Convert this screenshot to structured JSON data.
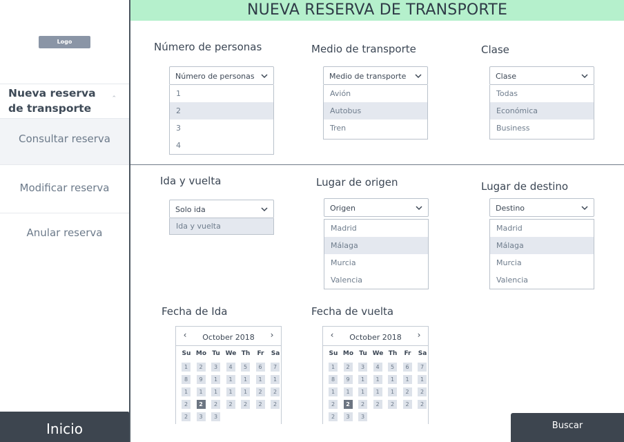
{
  "sidebar": {
    "logo": "Logo",
    "active_item": "Nueva reserva de transporte",
    "items": [
      {
        "label": "Consultar reserva"
      },
      {
        "label": "Modificar reserva"
      },
      {
        "label": "Anular reserva"
      }
    ],
    "home_button": "Inicio"
  },
  "header": {
    "title": "NUEVA RESERVA DE TRANSPORTE",
    "color": "#b5f0cc"
  },
  "form": {
    "personas": {
      "label": "Número de personas",
      "value": "Número de personas",
      "options": [
        "1",
        "2",
        "3",
        "4"
      ],
      "selected": "2"
    },
    "medio": {
      "label": "Medio de transporte",
      "value": "Medio de transporte",
      "options": [
        "Avión",
        "Autobus",
        "Tren"
      ],
      "selected": "Autobus"
    },
    "clase": {
      "label": "Clase",
      "value": "Clase",
      "options": [
        "Todas",
        "Económica",
        "Business"
      ],
      "selected": "Económica"
    },
    "ida_vuelta": {
      "label": "Ida y vuelta",
      "value": "Solo ida",
      "options": [
        "Ida y vuelta"
      ],
      "selected": "Ida y vuelta"
    },
    "origen": {
      "label": "Lugar de origen",
      "value": "Origen",
      "options": [
        "Madrid",
        "Málaga",
        "Murcia",
        "Valencia"
      ],
      "selected": "Málaga"
    },
    "destino": {
      "label": "Lugar de destino",
      "value": "Destino",
      "options": [
        "Madrid",
        "Málaga",
        "Murcia",
        "Valencia"
      ],
      "selected": "Málaga"
    },
    "fecha_ida": {
      "label": "Fecha de Ida"
    },
    "fecha_vuelta": {
      "label": "Fecha de vuelta"
    }
  },
  "calendar": {
    "month": "October 2018",
    "prev": "‹",
    "next": "›",
    "weekdays": [
      "Su",
      "Mo",
      "Tu",
      "We",
      "Th",
      "Fr",
      "Sa"
    ],
    "rows": [
      [
        "1",
        "2",
        "3",
        "4",
        "5",
        "6",
        "7"
      ],
      [
        "8",
        "9",
        "1",
        "1",
        "1",
        "1",
        "1"
      ],
      [
        "1",
        "1",
        "1",
        "1",
        "1",
        "2",
        "2"
      ],
      [
        "2",
        "2",
        "2",
        "2",
        "2",
        "2",
        "2"
      ],
      [
        "2",
        "3",
        "3"
      ]
    ],
    "today": "2"
  },
  "search_button": "Buscar"
}
